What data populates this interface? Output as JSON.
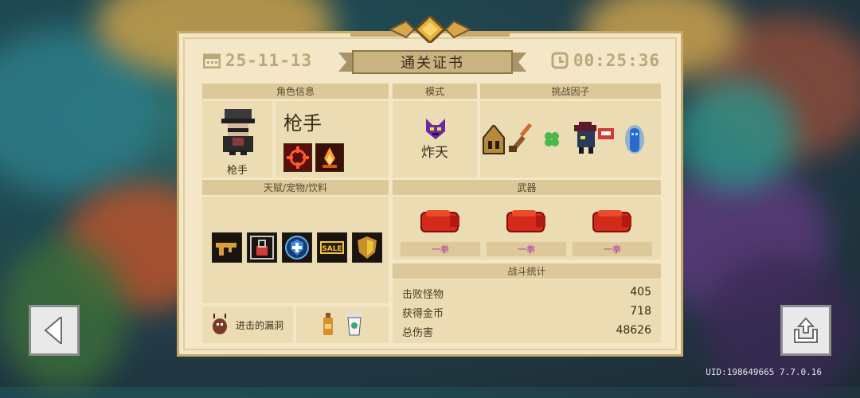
{
  "certificate": {
    "date": "25-11-13",
    "title": "通关证书",
    "time": "00:25:36"
  },
  "sections": {
    "character_info": "角色信息",
    "mode": "模式",
    "challenge_factors": "挑战因子",
    "talents_pets_drinks": "天赋/宠物/饮料",
    "weapons": "武器",
    "battle_stats": "战斗统计"
  },
  "character": {
    "name": "枪手",
    "portrait_label": "枪手"
  },
  "mode": {
    "name": "炸天"
  },
  "challenge_factor_icons": [
    "helmet-icon",
    "rifle-icon",
    "clover-icon",
    "hat-figure-icon",
    "blue-spirit-icon"
  ],
  "talent_icons": [
    "gun-talent-icon",
    "lock-talent-icon",
    "shield-cross-icon",
    "sale-icon",
    "gold-shield-icon"
  ],
  "pet": {
    "name": "进击的漏洞"
  },
  "weapons": [
    {
      "label": "一拳"
    },
    {
      "label": "一拳"
    },
    {
      "label": "一拳"
    }
  ],
  "stats": [
    {
      "label": "击败怪物",
      "value": "405"
    },
    {
      "label": "获得金币",
      "value": "718"
    },
    {
      "label": "总伤害",
      "value": "48626"
    }
  ],
  "uid_text": "UID:198649665 7.7.0.16",
  "colors": {
    "card": "#f3e7c7",
    "header": "#dcc898",
    "panel": "#ebdcb3",
    "weapon_label": "#b33aa8"
  }
}
